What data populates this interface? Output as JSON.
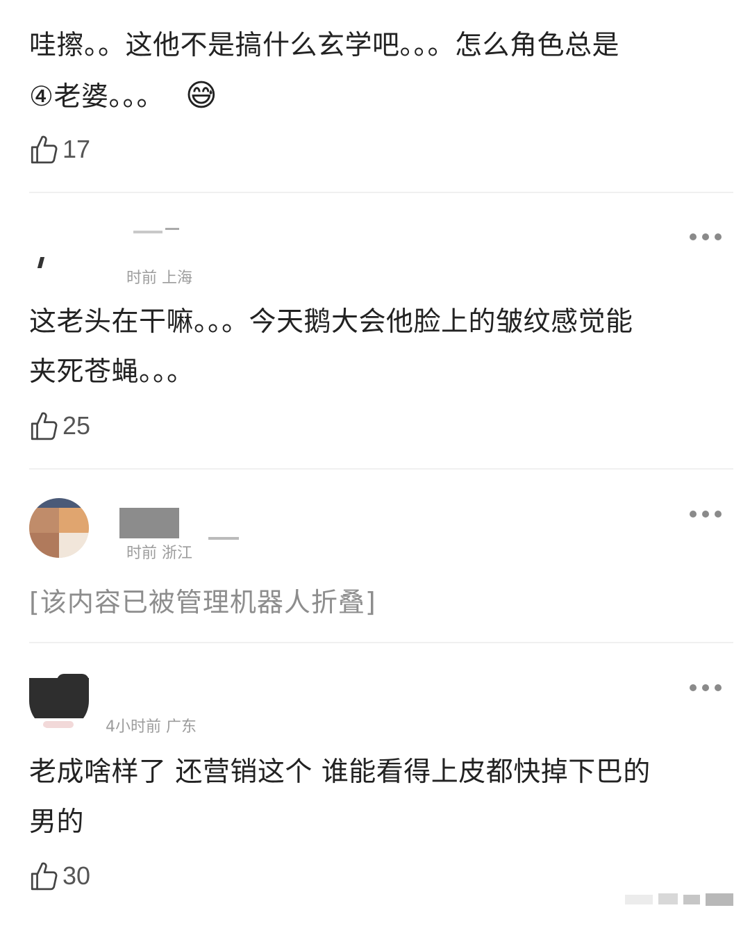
{
  "comments": [
    {
      "text_line1": "哇擦。。这他不是搞什么玄学吧。。。怎么角色总是",
      "text_line2": "④老婆。。。",
      "emoji": "😅",
      "likes": "17"
    },
    {
      "meta": "时前 上海",
      "text_line1": "这老头在干嘛。。。今天鹅大会他脸上的皱纹感觉能",
      "text_line2": "夹死苍蝇。。。",
      "likes": "25"
    },
    {
      "meta": "时前 浙江",
      "folded_text": "[该内容已被管理机器人折叠]"
    },
    {
      "meta": "4小时前 广东",
      "text_line1": "老成啥样了 还营销这个 谁能看得上皮都快掉下巴的",
      "text_line2": "男的",
      "likes": "30"
    }
  ],
  "icons": {
    "like": "thumbs-up-icon",
    "more": "more-options-icon"
  },
  "colors": {
    "text": "#222222",
    "secondary": "#9c9c9c",
    "folded": "#8d8d8d",
    "divider": "#f0f0f0"
  }
}
